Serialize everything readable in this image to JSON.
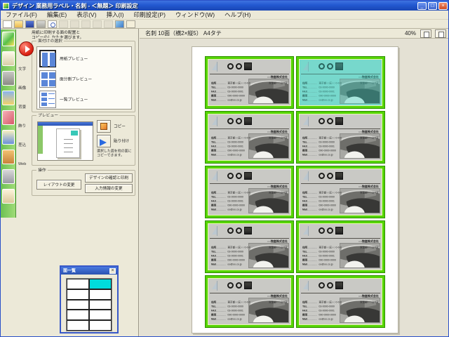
{
  "window": {
    "title": "デザイン 業務用ラベル・名刺 - ＜無題＞ 印刷設定",
    "controls": {
      "minimize": "_",
      "maximize": "□",
      "close": "×"
    }
  },
  "menubar": {
    "items": [
      "ファイル(F)",
      "編集(E)",
      "表示(V)",
      "挿入(I)",
      "印刷設定(P)",
      "ウィンドウ(W)",
      "ヘルプ(H)"
    ]
  },
  "toolbar": {
    "icons": [
      {
        "name": "new",
        "enabled": true
      },
      {
        "name": "open",
        "enabled": true
      },
      {
        "name": "save",
        "enabled": true
      },
      {
        "name": "print",
        "enabled": true
      },
      {
        "name": "print-preview",
        "enabled": true
      },
      {
        "name": "cut",
        "enabled": false
      },
      {
        "name": "copy",
        "enabled": false
      },
      {
        "name": "paste",
        "enabled": false
      },
      {
        "name": "undo",
        "enabled": false
      },
      {
        "name": "redo",
        "enabled": false
      },
      {
        "name": "insert-frame",
        "enabled": true
      },
      {
        "name": "help",
        "enabled": true
      }
    ]
  },
  "rail": {
    "tiles": [
      "app-logo",
      "paper",
      "printer",
      "folder",
      "parts",
      "text",
      "image",
      "background",
      "memo"
    ]
  },
  "rail_menu": {
    "items": [
      "文字",
      "画像",
      "背景",
      "飾り",
      "差込",
      "Web"
    ]
  },
  "side_panel": {
    "hint_line1": "用紙に印刷する面の配置と",
    "hint_line2": "コピーのしかたを選びます。",
    "layout_group": {
      "caption": "面付けの選択",
      "options": [
        {
          "label": "用紙プレビュー",
          "selected": true
        },
        {
          "label": "面分割プレビュー",
          "selected": false
        },
        {
          "label": "一覧プレビュー",
          "selected": false
        }
      ]
    },
    "preview_group": {
      "caption": "プレビュー",
      "copy_label": "コピー",
      "paste_label": "貼り付け",
      "note_line1": "選択した面を他の面に",
      "note_line2": "コピーできます。"
    },
    "actions_group": {
      "caption": "操作",
      "layout_button": "レイアウトの変更",
      "design_button": "デザインの確認と印刷",
      "input_button": "入力情報の変更"
    }
  },
  "mini_window": {
    "title": "面一覧",
    "close": "×",
    "rows": 5,
    "cols": 2,
    "selected_row": 0,
    "selected_col": 1
  },
  "main": {
    "header": {
      "sheet_label": "名刺 10面（横2×縦5） A4タテ",
      "zoom_value": "40%"
    },
    "cards": [
      {
        "selected": false
      },
      {
        "selected": true
      },
      {
        "selected": false
      },
      {
        "selected": false
      },
      {
        "selected": false
      },
      {
        "selected": false
      },
      {
        "selected": false
      },
      {
        "selected": false
      },
      {
        "selected": false
      },
      {
        "selected": false
      }
    ],
    "card": {
      "company": "○○物産株式会社",
      "name": "営業部　○山 ○男",
      "info_rows": [
        {
          "label": "住所",
          "value": "東京都○○区○○ 0-0-0"
        },
        {
          "label": "TEL",
          "value": "03-0000-0000"
        },
        {
          "label": "FAX",
          "value": "03-0000-0001"
        },
        {
          "label": "携帯",
          "value": "090-0000-0000"
        },
        {
          "label": "Mail",
          "value": "oo@oo.co.jp"
        }
      ]
    },
    "colors": {
      "card_border": "#55d400",
      "selected_tint": "#8fded4",
      "page": "#ffffff",
      "canvas": "#e4e1d4"
    }
  }
}
